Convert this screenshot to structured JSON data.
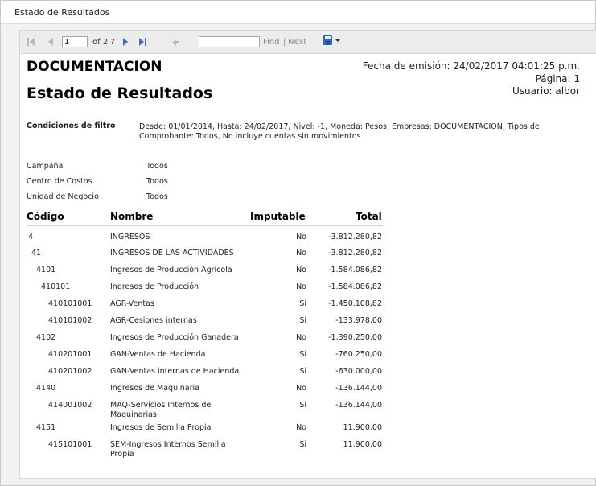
{
  "window": {
    "title": "Estado de Resultados"
  },
  "toolbar": {
    "page_value": "1",
    "page_of": "of 2 ?",
    "find_placeholder": "",
    "find_label": "Find",
    "separator": "|",
    "next_label": "Next"
  },
  "report": {
    "company": "DOCUMENTACION",
    "title": "Estado de Resultados",
    "issue_date": "Fecha de emisión: 24/02/2017 04:01:25 p.m.",
    "page": "Página: 1",
    "user": "Usuario: albor",
    "filter_label": "Condiciones de filtro",
    "filter_text_line1": "Desde: 01/01/2014, Hasta: 24/02/2017, Nivel: -1, Moneda: Pesos, Empresas: DOCUMENTACION, Tipos de",
    "filter_text_line2": "Comprobante: Todos, No incluye cuentas sin movimientos",
    "filters": [
      {
        "label": "Campaña",
        "value": "Todos"
      },
      {
        "label": "Centro de Costos",
        "value": "Todos"
      },
      {
        "label": "Unidad de Negocio",
        "value": "Todos"
      }
    ],
    "columns": {
      "code": "Código",
      "name": "Nombre",
      "imputable": "Imputable",
      "total": "Total"
    },
    "rows": [
      {
        "code": "4",
        "name": "INGRESOS",
        "name2": "",
        "imputable": "No",
        "total": "-3.812.280,82"
      },
      {
        "code": "41",
        "name": "INGRESOS DE LAS ACTIVIDADES",
        "name2": "",
        "imputable": "No",
        "total": "-3.812.280,82"
      },
      {
        "code": "4101",
        "name": "Ingresos de Producción Agrícola",
        "name2": "",
        "imputable": "No",
        "total": "-1.584.086,82"
      },
      {
        "code": "410101",
        "name": "Ingresos de Producción",
        "name2": "",
        "imputable": "No",
        "total": "-1.584.086,82"
      },
      {
        "code": "410101001",
        "name": "AGR-Ventas",
        "name2": "",
        "imputable": "Si",
        "total": "-1.450.108,82"
      },
      {
        "code": "410101002",
        "name": "AGR-Cesiones internas",
        "name2": "",
        "imputable": "Si",
        "total": "-133.978,00"
      },
      {
        "code": "4102",
        "name": "Ingresos de Producción Ganadera",
        "name2": "",
        "imputable": "No",
        "total": "-1.390.250,00"
      },
      {
        "code": "410201001",
        "name": "GAN-Ventas de Hacienda",
        "name2": "",
        "imputable": "Si",
        "total": "-760.250,00"
      },
      {
        "code": "410201002",
        "name": "GAN-Ventas internas de Hacienda",
        "name2": "",
        "imputable": "Si",
        "total": "-630.000,00"
      },
      {
        "code": "4140",
        "name": "Ingresos de Maquinaria",
        "name2": "",
        "imputable": "No",
        "total": "-136.144,00"
      },
      {
        "code": "414001002",
        "name": "MAQ-Servicios Internos de",
        "name2": "Maquinarias",
        "imputable": "Si",
        "total": "-136.144,00"
      },
      {
        "code": "4151",
        "name": "Ingresos de Semilla Propia",
        "name2": "",
        "imputable": "No",
        "total": "11.900,00"
      },
      {
        "code": "415101001",
        "name": "SEM-Ingresos Internos Semilla",
        "name2": "Propia",
        "imputable": "Si",
        "total": "11.900,00"
      }
    ]
  },
  "colors": {
    "link_blue": "#3b73c9",
    "toolbar_bg": "#ececec"
  }
}
